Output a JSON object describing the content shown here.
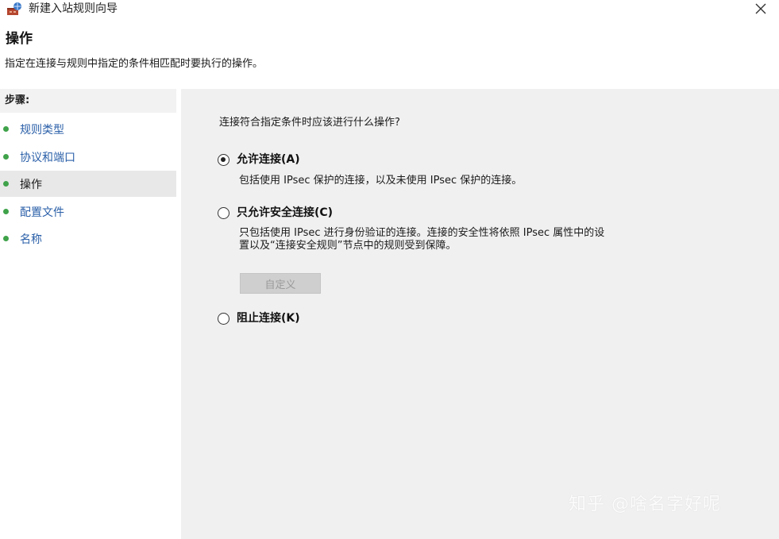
{
  "window": {
    "title": "新建入站规则向导",
    "close_glyph": "✕"
  },
  "header": {
    "title": "操作",
    "description": "指定在连接与规则中指定的条件相匹配时要执行的操作。"
  },
  "steps": {
    "heading": "步骤:",
    "items": [
      {
        "label": "规则类型",
        "current": false
      },
      {
        "label": "协议和端口",
        "current": false
      },
      {
        "label": "操作",
        "current": true
      },
      {
        "label": "配置文件",
        "current": false
      },
      {
        "label": "名称",
        "current": false
      }
    ]
  },
  "main": {
    "question": "连接符合指定条件时应该进行什么操作?",
    "options": [
      {
        "label": "允许连接(A)",
        "checked": true,
        "description": "包括使用 IPsec 保护的连接，以及未使用 IPsec 保护的连接。"
      },
      {
        "label": "只允许安全连接(C)",
        "checked": false,
        "description_line1": "只包括使用 IPsec 进行身份验证的连接。连接的安全性将依照 IPsec 属性中的设",
        "description_line2": "置以及“连接安全规则”节点中的规则受到保障。"
      },
      {
        "label": "阻止连接(K)",
        "checked": false
      }
    ],
    "customize_button": "自定义"
  },
  "watermark": "知乎 @啥名字好呢",
  "colors": {
    "link_blue": "#2a5fa8",
    "step_dot_green": "#3fa24a",
    "content_bg": "#f0f0f0"
  }
}
